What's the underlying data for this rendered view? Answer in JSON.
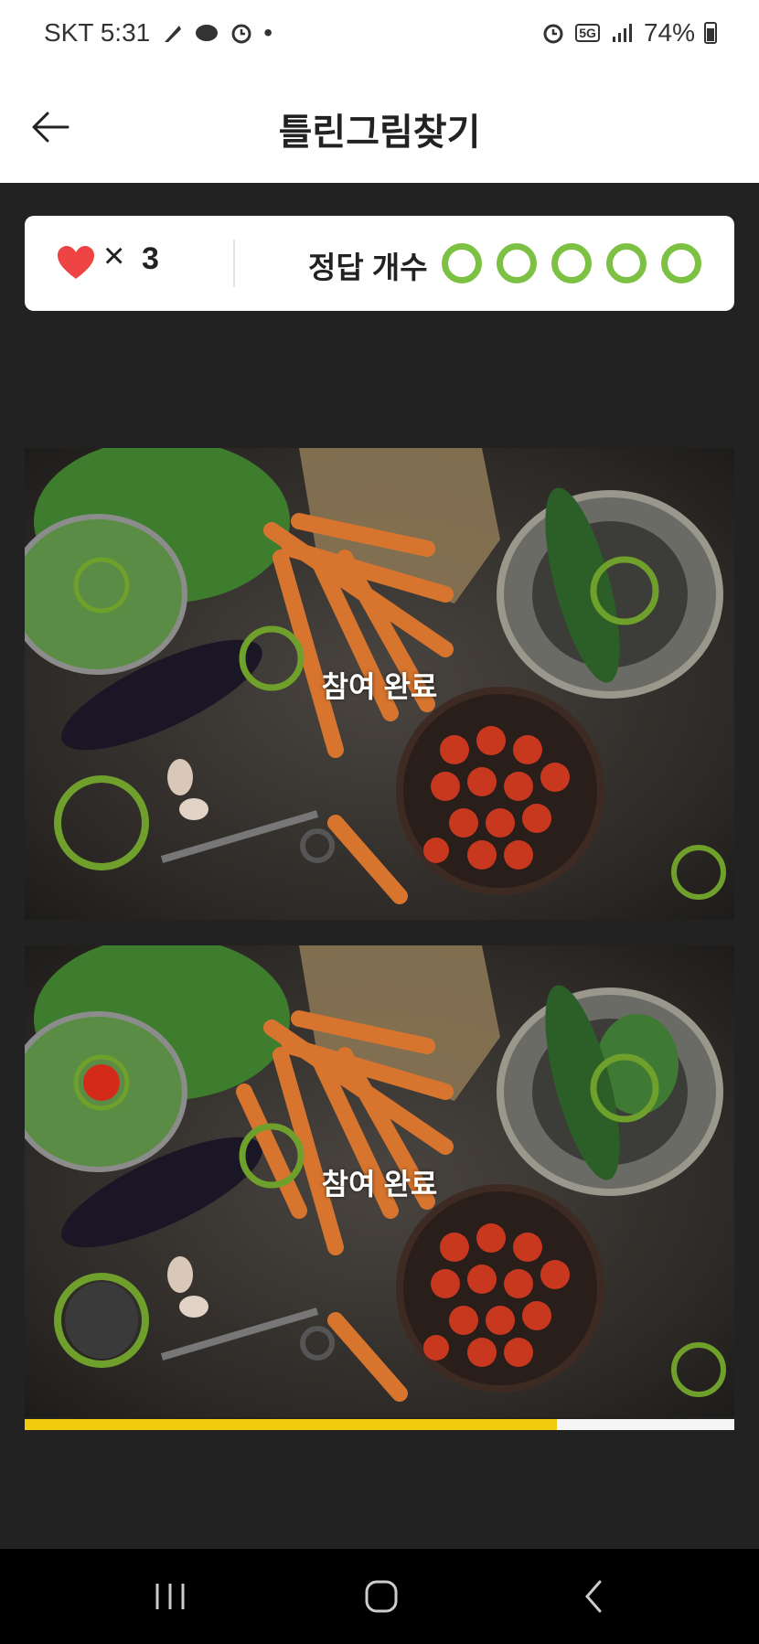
{
  "status_bar": {
    "carrier_time": "SKT 5:31",
    "dot": "•",
    "battery": "74%",
    "network": "5G",
    "icons": [
      "feather-icon",
      "cloud-chat-icon",
      "alarm-icon",
      "alarm-icon",
      "5g-icon",
      "signal-icon",
      "battery-icon"
    ]
  },
  "header": {
    "title": "틀린그림찾기",
    "back_icon": "arrow-left-icon"
  },
  "score": {
    "lives_icon": "heart-icon",
    "times": "×",
    "lives": "3",
    "answer_label": "정답 개수",
    "answers_found": 5,
    "answers_total": 5,
    "accent_color": "#7cc143"
  },
  "puzzle": {
    "top_overlay": "참여 완료",
    "bottom_overlay": "참여 완료",
    "found_circle_color": "#6fa02c"
  },
  "timer": {
    "progress": 0.75,
    "fill_color": "#f2cc0c"
  },
  "nav": {
    "icons": [
      "recent-apps-icon",
      "home-icon",
      "back-icon"
    ]
  }
}
